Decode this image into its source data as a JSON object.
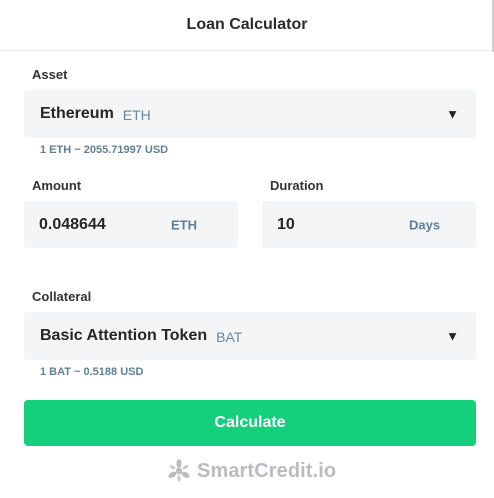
{
  "header": {
    "title": "Loan Calculator"
  },
  "asset": {
    "label": "Asset",
    "selected_name": "Ethereum",
    "selected_symbol": "ETH",
    "rate": "1 ETH ~ 2055.71997 USD"
  },
  "amount": {
    "label": "Amount",
    "value": "0.048644",
    "unit": "ETH"
  },
  "duration": {
    "label": "Duration",
    "value": "10",
    "unit": "Days"
  },
  "collateral": {
    "label": "Collateral",
    "selected_name": "Basic Attention Token",
    "selected_symbol": "BAT",
    "rate": "1 BAT ~ 0.5188 USD"
  },
  "actions": {
    "calculate_label": "Calculate"
  },
  "brand": {
    "name": "SmartCredit.io",
    "logo_icon": "smartcredit-logo-icon"
  },
  "icons": {
    "dropdown": "caret-down-icon"
  },
  "colors": {
    "accent": "#14cf7b",
    "muted_text": "#5f7f92",
    "field_bg": "#f4f5f7"
  }
}
